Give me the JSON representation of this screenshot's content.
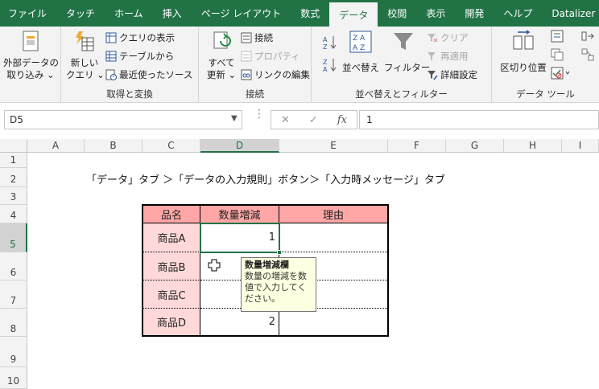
{
  "tabs": [
    "ファイル",
    "タッチ",
    "ホーム",
    "挿入",
    "ページ レイアウト",
    "数式",
    "データ",
    "校閲",
    "表示",
    "開発",
    "ヘルプ",
    "Datalizer"
  ],
  "active_tab": "データ",
  "ribbon": {
    "external_data": {
      "line1": "外部データの",
      "line2": "取り込み ⌄"
    },
    "new_query": {
      "line1": "新しい",
      "line2": "クエリ ⌄"
    },
    "show_queries": "クエリの表示",
    "from_table": "テーブルから",
    "recent_sources": "最近使ったソース",
    "group_get_transform": "取得と変換",
    "refresh_all": {
      "line1": "すべて",
      "line2": "更新 ⌄"
    },
    "connections": "接続",
    "properties": "プロパティ",
    "edit_links": "リンクの編集",
    "group_connections": "接続",
    "sort": "並べ替え",
    "filter": "フィルター",
    "clear": "クリア",
    "reapply": "再適用",
    "advanced": "詳細設定",
    "group_sort_filter": "並べ替えとフィルター",
    "text_to_columns": "区切り位置",
    "group_data_tools": "データ ツール"
  },
  "formula_bar": {
    "name_box": "D5",
    "fx": "fx",
    "content": "1"
  },
  "columns": [
    "A",
    "B",
    "C",
    "D",
    "E",
    "F",
    "G",
    "H",
    "I"
  ],
  "rows": [
    "1",
    "2",
    "3",
    "4",
    "5",
    "6",
    "7",
    "8",
    "9",
    "10"
  ],
  "instruction": "「データ」タブ ＞「データの入力規則」ボタン＞「入力時メッセージ」タブ",
  "table": {
    "headers": [
      "品名",
      "数量増減",
      "理由"
    ],
    "rows": [
      {
        "name": "商品A",
        "qty": "1",
        "reason": ""
      },
      {
        "name": "商品B",
        "qty": "",
        "reason": ""
      },
      {
        "name": "商品C",
        "qty": "",
        "reason": ""
      },
      {
        "name": "商品D",
        "qty": "2",
        "reason": ""
      }
    ]
  },
  "tooltip": {
    "title": "数量増減欄",
    "body": "数量の増減を数値で入力してください。"
  },
  "colors": {
    "excel_green": "#217346",
    "header_fill": "#ffa6a6",
    "name_fill": "#ffd9d9"
  }
}
